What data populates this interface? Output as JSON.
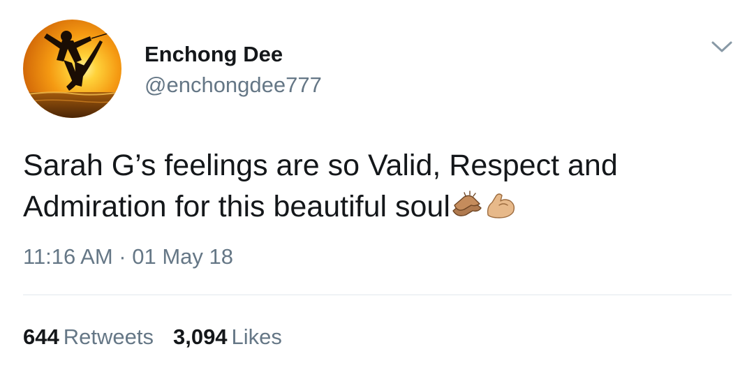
{
  "user": {
    "display_name": "Enchong Dee",
    "handle": "@enchongdee777",
    "avatar_icon": "wakeboarder-sunset-avatar"
  },
  "menu": {
    "icon": "chevron-down-icon"
  },
  "tweet": {
    "text": "Sarah G’s feelings are so Valid, Respect and Admiration for this beautiful soul",
    "emojis": [
      "clapping-hands-icon",
      "flexed-biceps-icon"
    ],
    "timestamp": "11:16 AM · 01 May 18"
  },
  "stats": {
    "retweets_count": "644",
    "retweets_label": "Retweets",
    "likes_count": "3,094",
    "likes_label": "Likes"
  },
  "colors": {
    "text_primary": "#14171a",
    "text_secondary": "#657786",
    "divider": "#e1e8ed",
    "skin_tone": "#b07a4f"
  }
}
